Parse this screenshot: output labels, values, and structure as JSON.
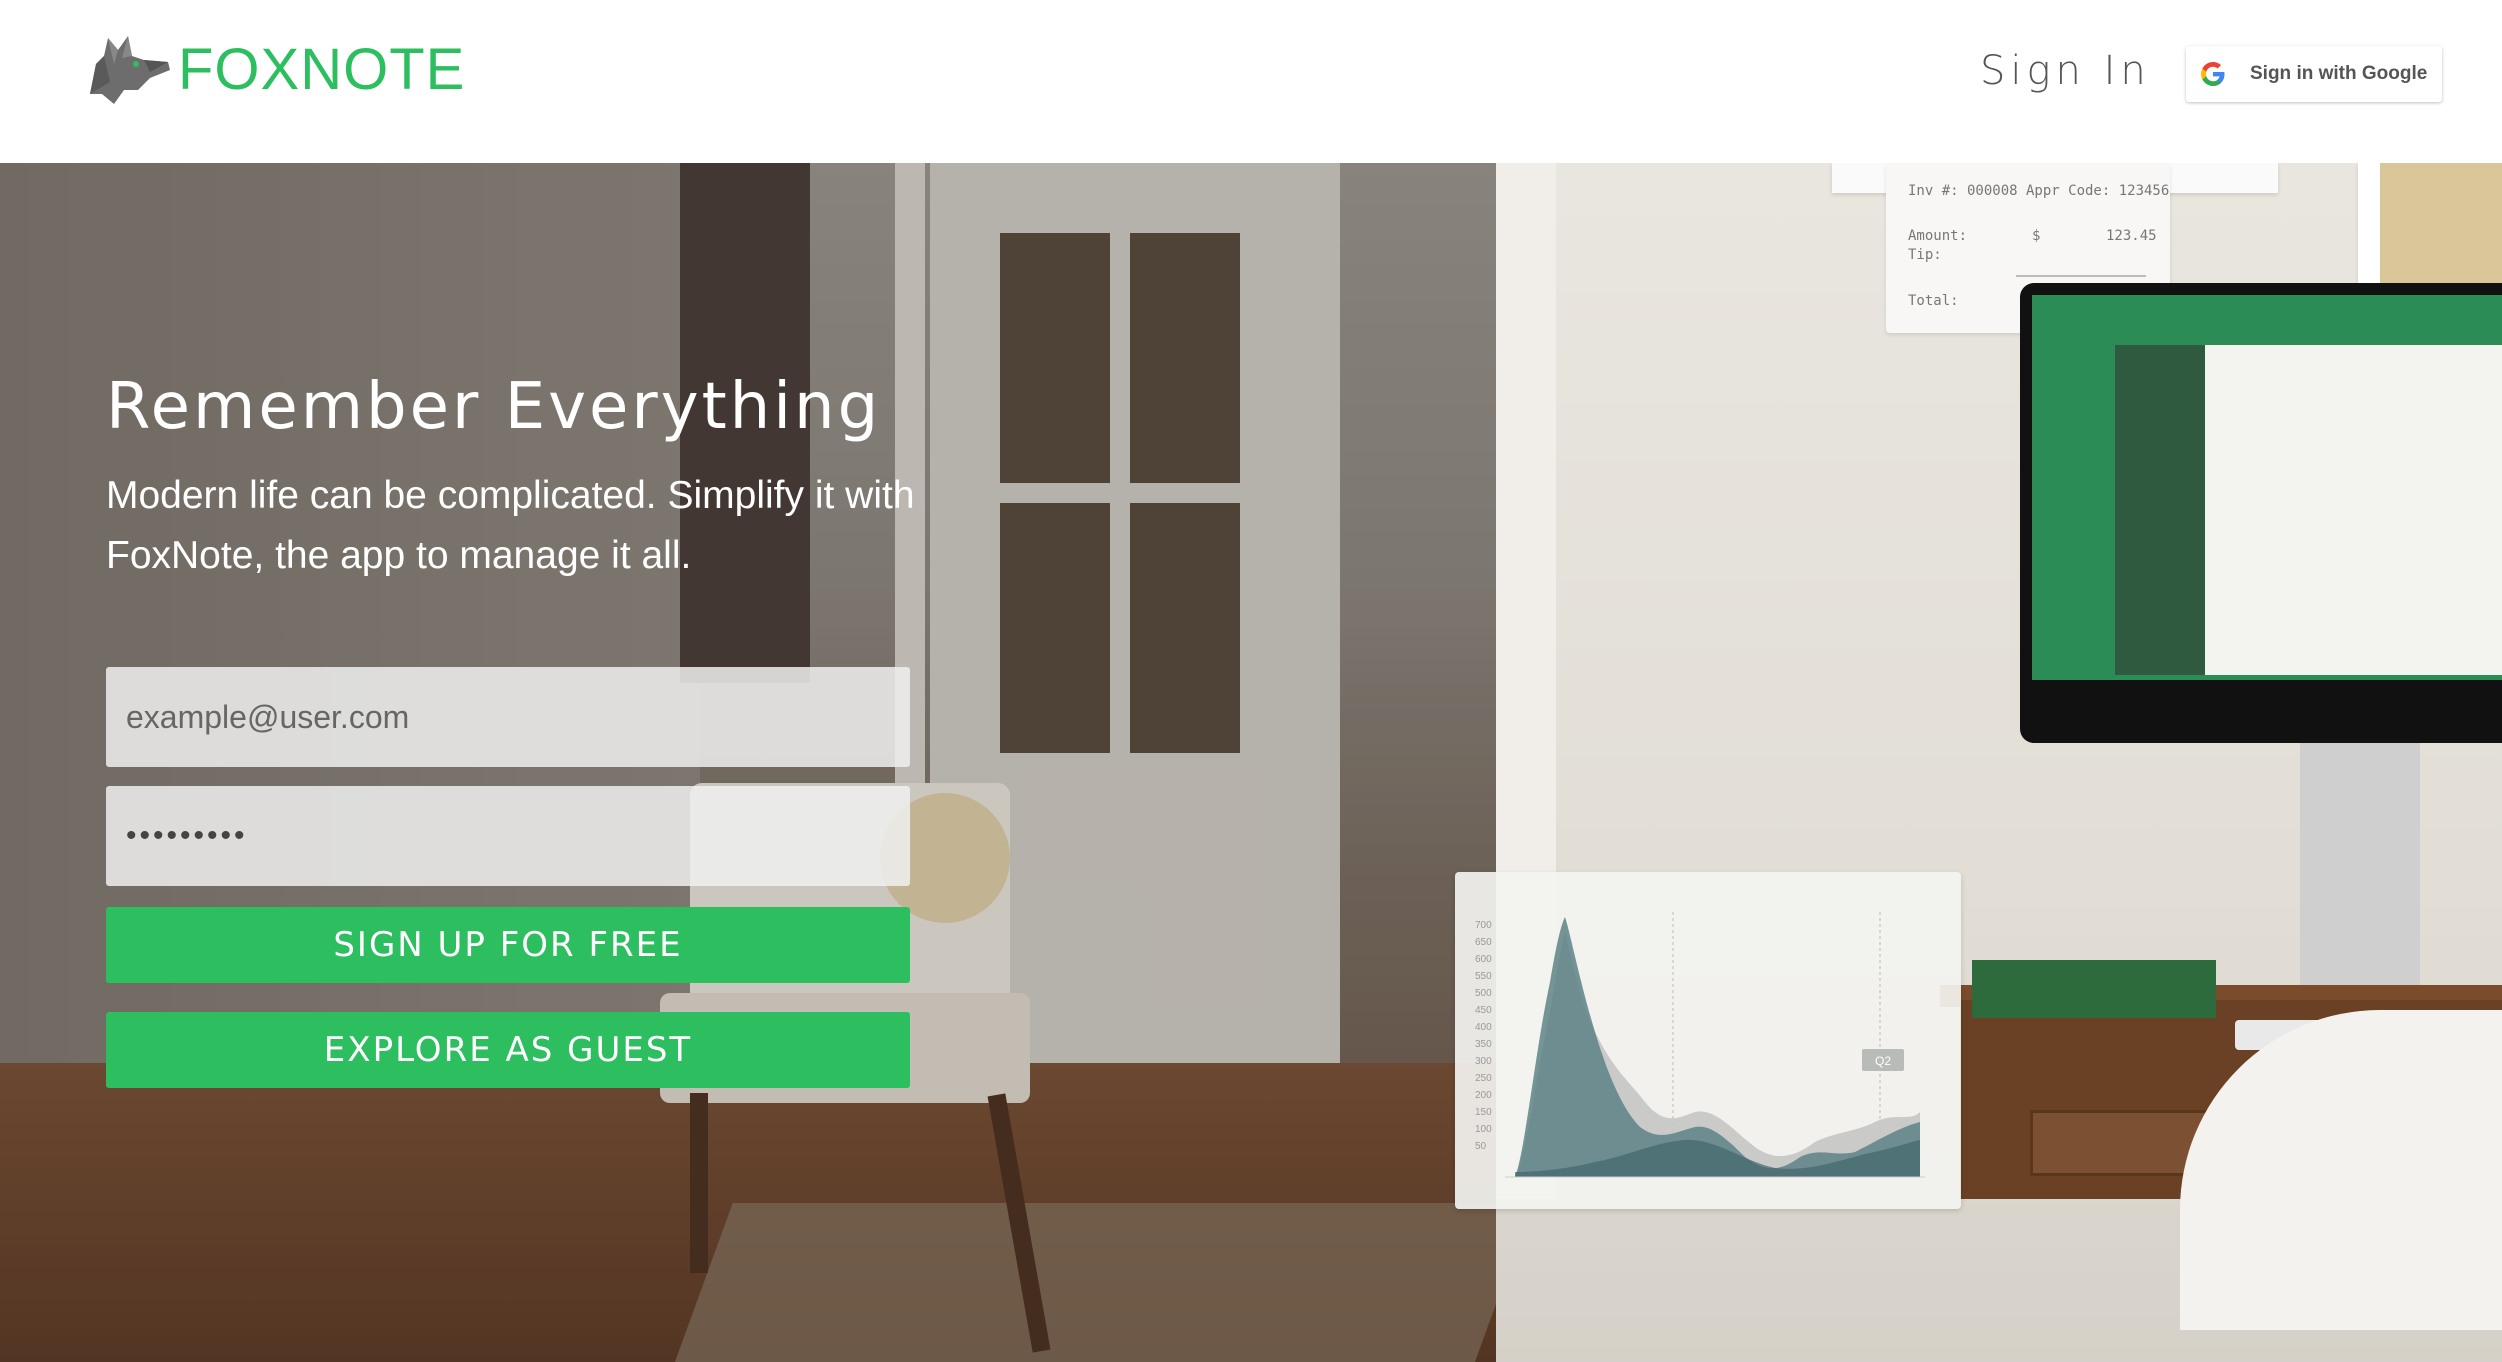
{
  "header": {
    "brand_name": "FOXNOTE",
    "sign_in_label": "Sign In",
    "google_button_label": "Sign in with Google"
  },
  "hero": {
    "title": "Remember Everything",
    "subtitle": "Modern life can be complicated. Simplify it with FoxNote, the app to manage it all."
  },
  "form": {
    "email_placeholder": "example@user.com",
    "password_value": "•••••••••",
    "signup_label": "SIGN UP FOR FREE",
    "guest_label": "EXPLORE AS GUEST"
  },
  "background_decor": {
    "receipt": {
      "line1": "Inv #: 000008   Appr Code: 123456",
      "amount_label": "Amount:",
      "amount_currency": "$",
      "amount_value": "123.45",
      "tip_label": "Tip:",
      "total_label": "Total:"
    },
    "chart": {
      "y_ticks": [
        "700",
        "650",
        "600",
        "550",
        "500",
        "450",
        "400",
        "350",
        "300",
        "250",
        "200",
        "150",
        "100",
        "50"
      ],
      "marker_label": "Q2"
    }
  },
  "colors": {
    "brand_green": "#2dbe60",
    "text_gray": "#555555"
  },
  "icons": {
    "logo": "fox-logo-icon",
    "google": "google-g-icon"
  }
}
